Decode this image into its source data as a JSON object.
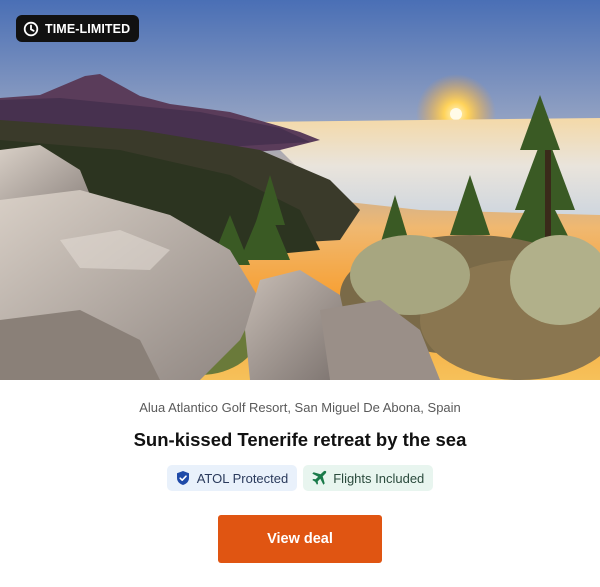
{
  "badge": {
    "label": "TIME-LIMITED",
    "icon": "clock-icon"
  },
  "hero": {
    "image": "Sunset over Tenerife coast with Mount Teide, pine trees and rocks"
  },
  "hotel": {
    "location": "Alua Atlantico Golf Resort, San Miguel De Abona, Spain",
    "title": "Sun-kissed Tenerife retreat by the sea"
  },
  "tags": [
    {
      "label": "ATOL Protected",
      "icon": "shield-icon",
      "color": "#1f4aa8"
    },
    {
      "label": "Flights Included",
      "icon": "airplane-icon",
      "color": "#1a7a4a"
    }
  ],
  "cta": {
    "label": "View deal",
    "color": "#e05512"
  }
}
